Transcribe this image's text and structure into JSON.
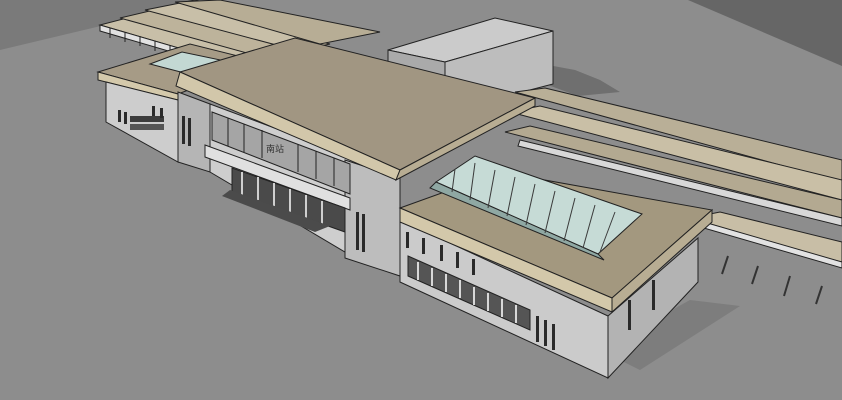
{
  "scene": {
    "subject": "station-building-3d-model",
    "colors": {
      "ground": "#8d8d8d",
      "sky": "#666666",
      "roof_top": "#a29784",
      "roof_edge": "#cfc4a6",
      "wall": "#c9c9c9",
      "wall_dark": "#9c9c9c",
      "glass": "#c6dbd6",
      "outline": "#1e1e1e"
    },
    "facade_sign": "南站"
  }
}
